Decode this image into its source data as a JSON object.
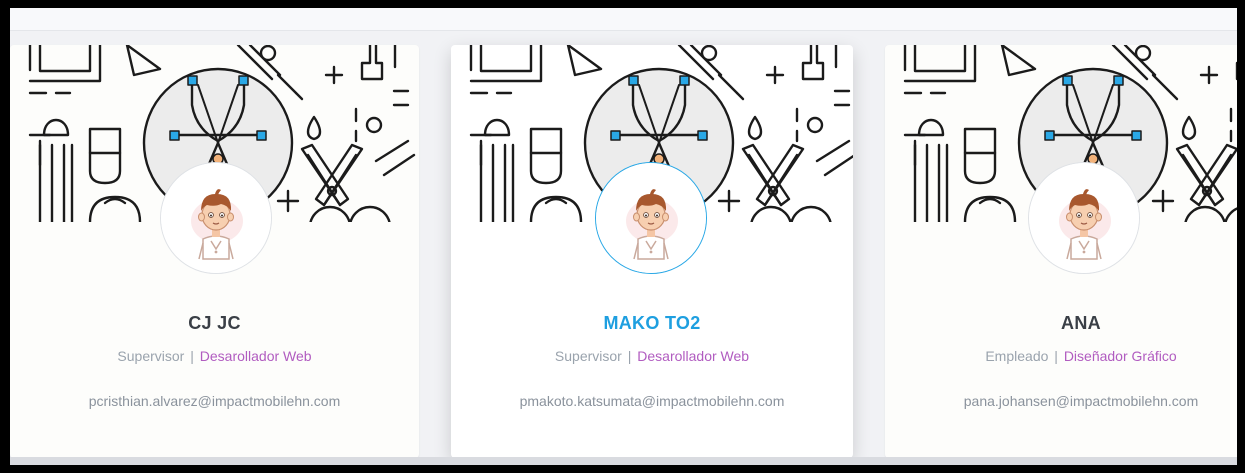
{
  "colors": {
    "active_accent": "#1e9fe0",
    "department": "#b15cc0",
    "muted_text": "#9aa3ad",
    "name_text": "#3a3f46"
  },
  "cards": [
    {
      "name": "CJ JC",
      "position": "Supervisor",
      "separator": "|",
      "department": "Desarollador Web",
      "email": "pcristhian.alvarez@impactmobilehn.com",
      "avatar": "cartoon-boy-avatar",
      "active": false
    },
    {
      "name": "MAKO TO2",
      "position": "Supervisor",
      "separator": "|",
      "department": "Desarollador Web",
      "email": "pmakoto.katsumata@impactmobilehn.com",
      "avatar": "cartoon-boy-avatar",
      "active": true
    },
    {
      "name": "ANA",
      "position": "Empleado",
      "separator": "|",
      "department": "Diseñador Gráfico",
      "email": "pana.johansen@impactmobilehn.com",
      "avatar": "cartoon-boy-avatar",
      "active": false
    }
  ]
}
